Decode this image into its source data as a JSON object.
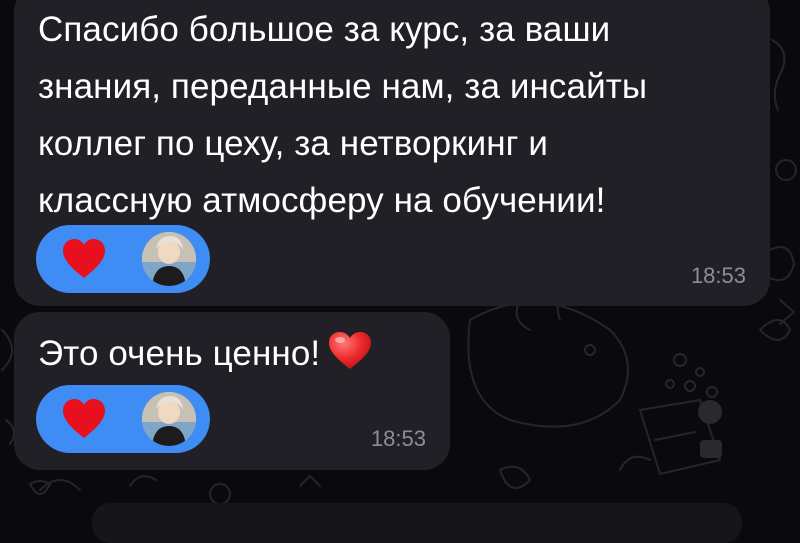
{
  "messages": [
    {
      "text": "Спасибо большое за курс, за ваши\nзнания, переданные нам, за инсайты\nколлег по цеху, за нетворкинг и\nклассную атмосферу на обучении!",
      "time": "18:53",
      "reaction": {
        "emoji": "heart-icon",
        "color": "#e8101e"
      }
    },
    {
      "text": "Это очень ценно!",
      "inline_emoji": "heart-emoji-icon",
      "time": "18:53",
      "reaction": {
        "emoji": "heart-icon",
        "color": "#e8101e"
      }
    }
  ],
  "colors": {
    "background": "#0a0a0c",
    "bubble": "#212026",
    "reaction_pill": "#3e8cf4",
    "timestamp": "#8e8d96"
  }
}
